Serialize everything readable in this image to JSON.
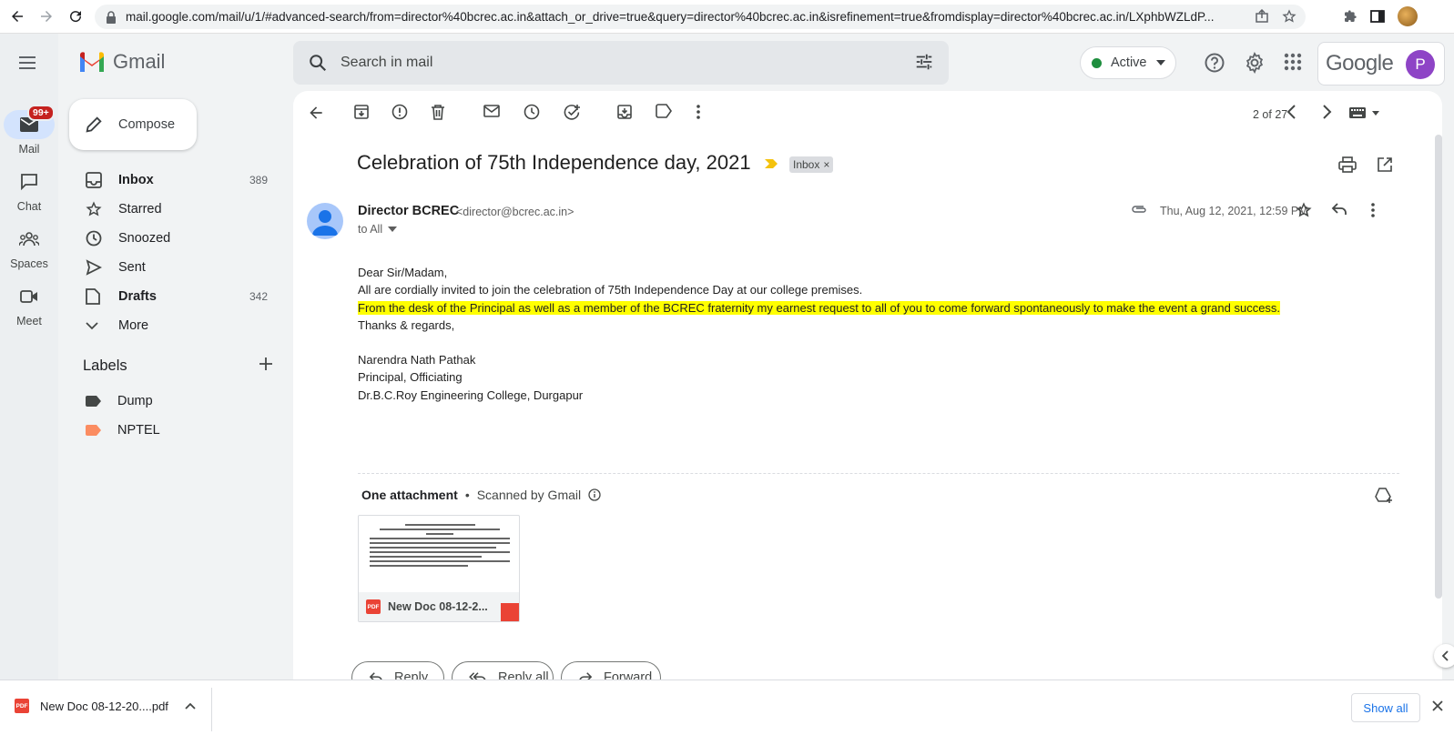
{
  "browser": {
    "url": "mail.google.com/mail/u/1/#advanced-search/from=director%40bcrec.ac.in&attach_or_drive=true&query=director%40bcrec.ac.in&isrefinement=true&fromdisplay=director%40bcrec.ac.in/LXphbWZLdP..."
  },
  "rail": {
    "items": [
      {
        "label": "Mail",
        "badge": "99+"
      },
      {
        "label": "Chat"
      },
      {
        "label": "Spaces"
      },
      {
        "label": "Meet"
      }
    ]
  },
  "header": {
    "app_name": "Gmail",
    "search_placeholder": "Search in mail",
    "status": "Active",
    "google_word": "Google",
    "avatar_letter": "P"
  },
  "sidebar": {
    "compose_label": "Compose",
    "items": [
      {
        "label": "Inbox",
        "count": "389"
      },
      {
        "label": "Starred",
        "count": ""
      },
      {
        "label": "Snoozed",
        "count": ""
      },
      {
        "label": "Sent",
        "count": ""
      },
      {
        "label": "Drafts",
        "count": "342"
      },
      {
        "label": "More",
        "count": ""
      }
    ],
    "labels_title": "Labels",
    "labels": [
      {
        "label": "Dump",
        "color": "#444746"
      },
      {
        "label": "NPTEL",
        "color": "#fb8c61"
      }
    ]
  },
  "toolbar": {
    "pager": "2 of 27"
  },
  "message": {
    "subject": "Celebration of 75th Independence day, 2021",
    "chip": "Inbox",
    "sender_name": "Director BCREC",
    "sender_email": "<director@bcrec.ac.in>",
    "to": "to All",
    "date": "Thu, Aug 12, 2021, 12:59 PM",
    "body": {
      "line1": "Dear Sir/Madam,",
      "line2": "All are cordially invited to join the celebration of 75th Independence Day at our college premises.",
      "line3": "From the desk of the Principal as well as a member of the BCREC fraternity my earnest request to all of you to come forward spontaneously to make the event a grand success.",
      "line4": "Thanks & regards,",
      "sig1": "Narendra Nath Pathak",
      "sig2": "Principal, Officiating",
      "sig3": "Dr.B.C.Roy Engineering College, Durgapur"
    },
    "attachment": {
      "title": "One attachment",
      "scan": "Scanned by Gmail",
      "file_name": "New Doc 08-12-2...",
      "type_label": "PDF"
    },
    "actions": {
      "reply": "Reply",
      "reply_all": "Reply all",
      "forward": "Forward"
    }
  },
  "download_bar": {
    "file": "New Doc 08-12-20....pdf",
    "show_all": "Show all"
  },
  "colors": {
    "highlight": "#ffff00",
    "accent_blue": "#1a73e8",
    "active_green": "#1e8e3e"
  }
}
